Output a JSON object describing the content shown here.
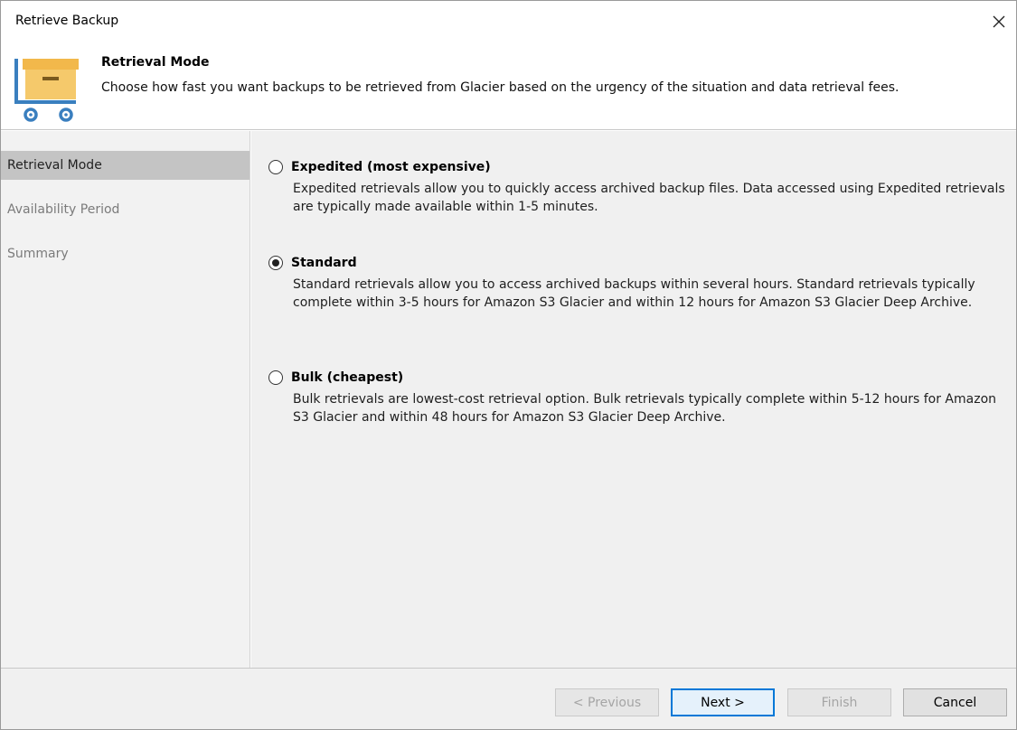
{
  "window": {
    "title": "Retrieve Backup",
    "close_icon": "close-icon"
  },
  "header": {
    "title": "Retrieval Mode",
    "description": "Choose how fast you want backups to be retrieved from Glacier based on the urgency of the situation and data retrieval fees.",
    "icon": "archive-box-cart-icon"
  },
  "sidebar": {
    "items": [
      {
        "label": "Retrieval Mode",
        "active": true
      },
      {
        "label": "Availability Period",
        "active": false
      },
      {
        "label": "Summary",
        "active": false
      }
    ]
  },
  "options": [
    {
      "label": "Expedited (most expensive)",
      "description": "Expedited retrievals allow you to quickly access archived backup files. Data accessed using Expedited retrievals are typically made available within 1-5 minutes.",
      "selected": false
    },
    {
      "label": "Standard",
      "description": "Standard retrievals allow you to access archived backups within several hours. Standard retrievals typically complete within 3-5 hours for Amazon S3 Glacier and within 12 hours for Amazon S3 Glacier Deep Archive.",
      "selected": true
    },
    {
      "label": "Bulk (cheapest)",
      "description": "Bulk retrievals are lowest-cost retrieval option. Bulk retrievals typically complete within 5-12 hours for Amazon S3 Glacier and within 48 hours for Amazon S3 Glacier Deep Archive.",
      "selected": false
    }
  ],
  "footer": {
    "previous_label": "< Previous",
    "next_label": "Next >",
    "finish_label": "Finish",
    "cancel_label": "Cancel"
  },
  "colors": {
    "accent": "#0078d7",
    "box": "#f5c96b",
    "cart": "#3a7fbf"
  }
}
